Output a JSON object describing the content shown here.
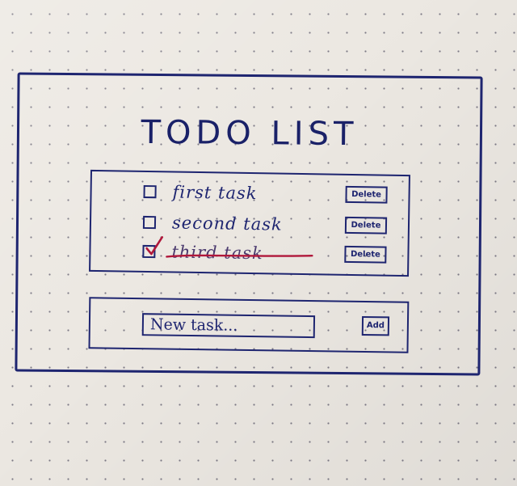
{
  "app": {
    "title": "TODO LIST"
  },
  "tasks": [
    {
      "label": "first task",
      "checked": false,
      "delete_label": "Delete"
    },
    {
      "label": "second task",
      "checked": false,
      "delete_label": "Delete"
    },
    {
      "label": "third task",
      "checked": true,
      "delete_label": "Delete"
    }
  ],
  "new_task": {
    "value": "",
    "placeholder": "New task...",
    "add_label": "Add"
  },
  "colors": {
    "ink": "#1e2570",
    "check": "#b0173a",
    "paper": "#ece8e2"
  }
}
